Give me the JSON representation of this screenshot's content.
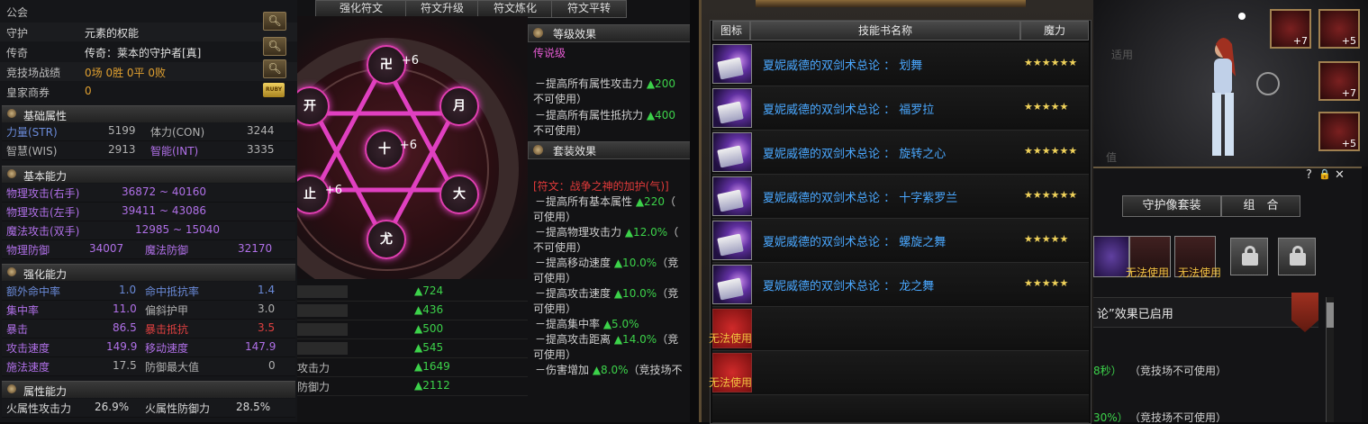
{
  "left_panel": {
    "top_rows": [
      {
        "label": "公会",
        "value": ""
      },
      {
        "label": "守护",
        "value": "元素的权能"
      },
      {
        "label": "传奇",
        "value": "传奇：莱本的守护者[真]"
      },
      {
        "label": "竞技场战绩",
        "value": "0场 0胜 0平 0败"
      },
      {
        "label": "皇家商券",
        "value": "0"
      }
    ],
    "magnifier_icon": "magnifier-icon",
    "coin_text": "RUBY",
    "basic_attributes": {
      "title": "基础属性",
      "rows": [
        {
          "l1": "力量(STR)",
          "v1": "5199",
          "l2": "体力(CON)",
          "v2": "3244"
        },
        {
          "l1": "智慧(WIS)",
          "v1": "2913",
          "l2": "智能(INT)",
          "v2": "3335"
        }
      ]
    },
    "basic_ability": {
      "title": "基本能力",
      "rows": [
        {
          "label": "物理攻击(右手)",
          "value": "36872 ~ 40160"
        },
        {
          "label": "物理攻击(左手)",
          "value": "39411 ~ 43086"
        },
        {
          "label": "魔法攻击(双手)",
          "value": "12985 ~ 15040"
        }
      ],
      "defense": {
        "l1": "物理防御",
        "v1": "34007",
        "l2": "魔法防御",
        "v2": "32170"
      }
    },
    "enhance_ability": {
      "title": "强化能力",
      "rows": [
        {
          "l1": "额外命中率",
          "v1": "1.0",
          "l2": "命中抵抗率",
          "v2": "1.4"
        },
        {
          "l1": "集中率",
          "v1": "11.0",
          "l2": "偏斜护甲",
          "v2": "3.0"
        },
        {
          "l1": "暴击",
          "v1": "86.5",
          "l2": "暴击抵抗",
          "v2": "3.5"
        },
        {
          "l1": "攻击速度",
          "v1": "149.9",
          "l2": "移动速度",
          "v2": "147.9"
        },
        {
          "l1": "施法速度",
          "v1": "17.5",
          "l2": "防御最大值",
          "v2": "0"
        }
      ]
    },
    "attribute_ability": {
      "title": "属性能力",
      "row": {
        "l1": "火属性攻击力",
        "v1": "26.9%",
        "l2": "火属性防御力",
        "v2": "28.5%"
      }
    }
  },
  "rune_panel": {
    "tabs": [
      "强化符文",
      "符文升级",
      "符文炼化",
      "符文平转"
    ],
    "rune_glyphs": [
      {
        "glyph": "卍",
        "sub": "+6"
      },
      {
        "glyph": "开",
        "sub": ""
      },
      {
        "glyph": "月",
        "sub": ""
      },
      {
        "glyph": "十",
        "sub": "+6"
      },
      {
        "glyph": "止",
        "sub": "+6"
      },
      {
        "glyph": "大",
        "sub": ""
      },
      {
        "glyph": "尤",
        "sub": ""
      }
    ],
    "stat_rows": [
      {
        "label": "",
        "value": "▲724"
      },
      {
        "label": "",
        "value": "▲436"
      },
      {
        "label": "",
        "value": "▲500"
      },
      {
        "label": "",
        "value": "▲545"
      },
      {
        "label": "攻击力",
        "value": "▲1649"
      },
      {
        "label": "防御力",
        "value": "▲2112"
      }
    ],
    "level_effect": {
      "title": "等级效果",
      "grade": "传说级",
      "lines": [
        {
          "text": "－提高所有属性攻击力 ",
          "green": "▲200"
        },
        {
          "text": "不可使用）",
          "green": ""
        },
        {
          "text": "－提高所有属性抵抗力 ",
          "green": "▲400"
        },
        {
          "text": "不可使用）",
          "green": ""
        }
      ]
    },
    "set_effect": {
      "title": "套装效果",
      "set_name": "[符文：战争之神的加护(气)]",
      "lines": [
        {
          "text": "－提高所有基本属性 ",
          "green": "▲220",
          "tail": "（"
        },
        {
          "text": "可使用）",
          "green": "",
          "tail": ""
        },
        {
          "text": "－提高物理攻击力 ",
          "green": "▲12.0%",
          "tail": "（"
        },
        {
          "text": "不可使用）",
          "green": "",
          "tail": ""
        },
        {
          "text": "－提高移动速度 ",
          "green": "▲10.0%",
          "tail": "（竞"
        },
        {
          "text": "可使用）",
          "green": "",
          "tail": ""
        },
        {
          "text": "－提高攻击速度 ",
          "green": "▲10.0%",
          "tail": "（竞"
        },
        {
          "text": "可使用）",
          "green": "",
          "tail": ""
        },
        {
          "text": "－提高集中率 ",
          "green": "▲5.0%",
          "tail": ""
        },
        {
          "text": "－提高攻击距离 ",
          "green": "▲14.0%",
          "tail": "（竞"
        },
        {
          "text": "可使用）",
          "green": "",
          "tail": ""
        },
        {
          "text": "－伤害增加 ",
          "green": "▲8.0%",
          "tail": "（竞技场不"
        }
      ]
    }
  },
  "skill_popup": {
    "headers": {
      "icon": "图标",
      "name": "技能书名称",
      "mana": "魔力"
    },
    "books": [
      {
        "name": "夏妮威德的双剑术总论 ： 划舞",
        "stars": "★★★★★★"
      },
      {
        "name": "夏妮威德的双剑术总论 ： 福罗拉",
        "stars": "★★★★★"
      },
      {
        "name": "夏妮威德的双剑术总论 ： 旋转之心",
        "stars": "★★★★★★"
      },
      {
        "name": "夏妮威德的双剑术总论 ： 十字紫罗兰",
        "stars": "★★★★★★"
      },
      {
        "name": "夏妮威德的双剑术总论 ： 螺旋之舞",
        "stars": "★★★★★"
      },
      {
        "name": "夏妮威德的双剑术总论 ： 龙之舞",
        "stars": "★★★★★"
      }
    ],
    "unusable": [
      "无法使用",
      "无法使用"
    ]
  },
  "right_panel": {
    "slots_plus": [
      "+7",
      "+5",
      "+7",
      "+5"
    ],
    "window_buttons": [
      "?",
      "🔒",
      "✕"
    ],
    "tabs": [
      "守护像套装",
      "组　合"
    ],
    "unusable_labels": [
      "无法使用",
      "无法使用"
    ],
    "effect_text": "论”效果已启用",
    "lower_text": "（竞技场不可使用）",
    "lower_text2": "（竞技场不可使用）",
    "seconds_text": "8秒）",
    "percent_text": "30%）",
    "ghost_texts": [
      "适用",
      "值"
    ]
  }
}
